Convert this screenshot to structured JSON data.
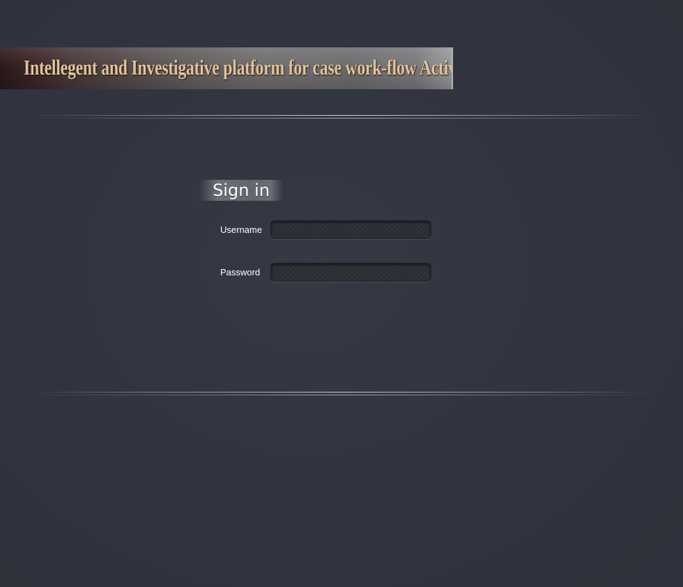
{
  "banner": {
    "title": "Intellegent and Investigative platform for case work-flow Activity"
  },
  "signin": {
    "heading": "Sign in",
    "username_label": "Username",
    "username_value": "",
    "password_label": "Password",
    "password_value": ""
  },
  "colors": {
    "background": "#323540",
    "banner_text": "#e2c49a",
    "label_text": "#ffffff"
  }
}
